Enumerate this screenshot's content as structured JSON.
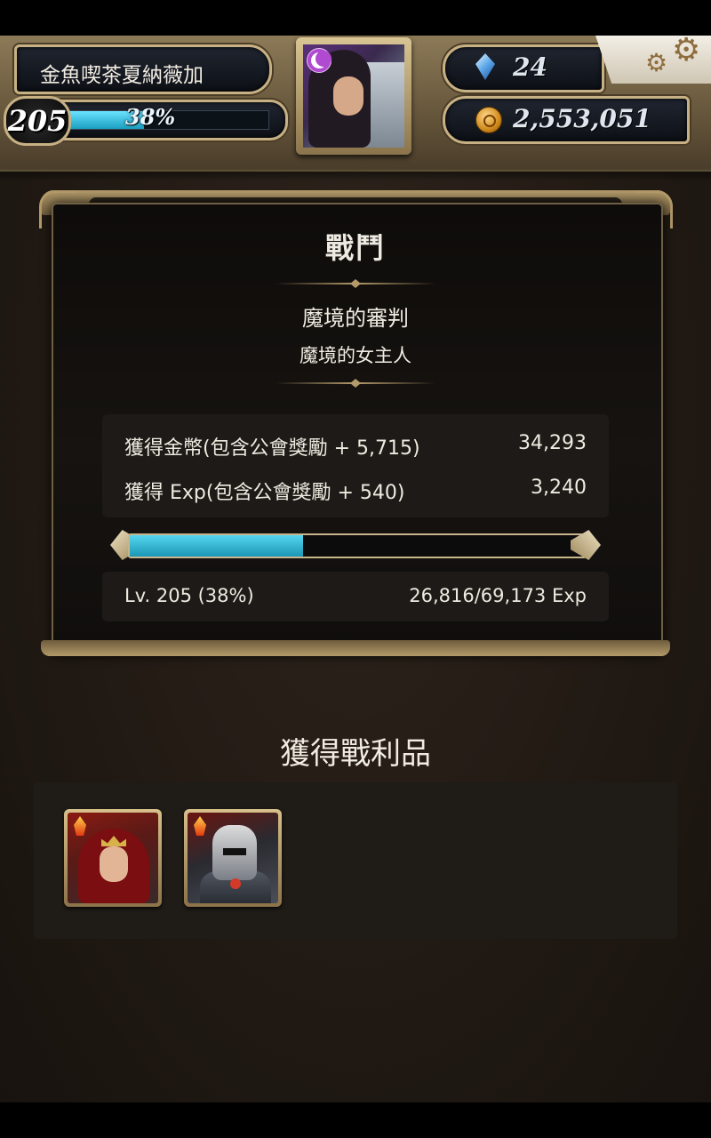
{
  "player": {
    "name": "金魚喫茶夏納薇加",
    "level": "205",
    "exp_percent_label": "38%",
    "exp_fraction": 0.38,
    "gems": "24",
    "gold": "2,553,051",
    "avatar_icon": "leader-portrait"
  },
  "battle": {
    "title": "戰鬥",
    "quest_name": "魔境的審判",
    "stage_name": "魔境的女主人",
    "rewards": [
      {
        "label": "獲得金幣(包含公會獎勵 + 5,715)",
        "value": "34,293"
      },
      {
        "label": "獲得 Exp(包含公會獎勵 + 540)",
        "value": "3,240"
      }
    ],
    "exp_bar_fraction": 0.38,
    "level_text": "Lv. 205 (38%)",
    "exp_text": "26,816/69,173 Exp"
  },
  "loot": {
    "title": "獲得戰利品",
    "items": [
      {
        "icon": "fire-element-queen-card"
      },
      {
        "icon": "fire-element-knight-card"
      }
    ]
  },
  "colors": {
    "exp_bar": "#1a9ec0",
    "frame_gold": "#b39a6a",
    "panel_bg": "#161310"
  }
}
